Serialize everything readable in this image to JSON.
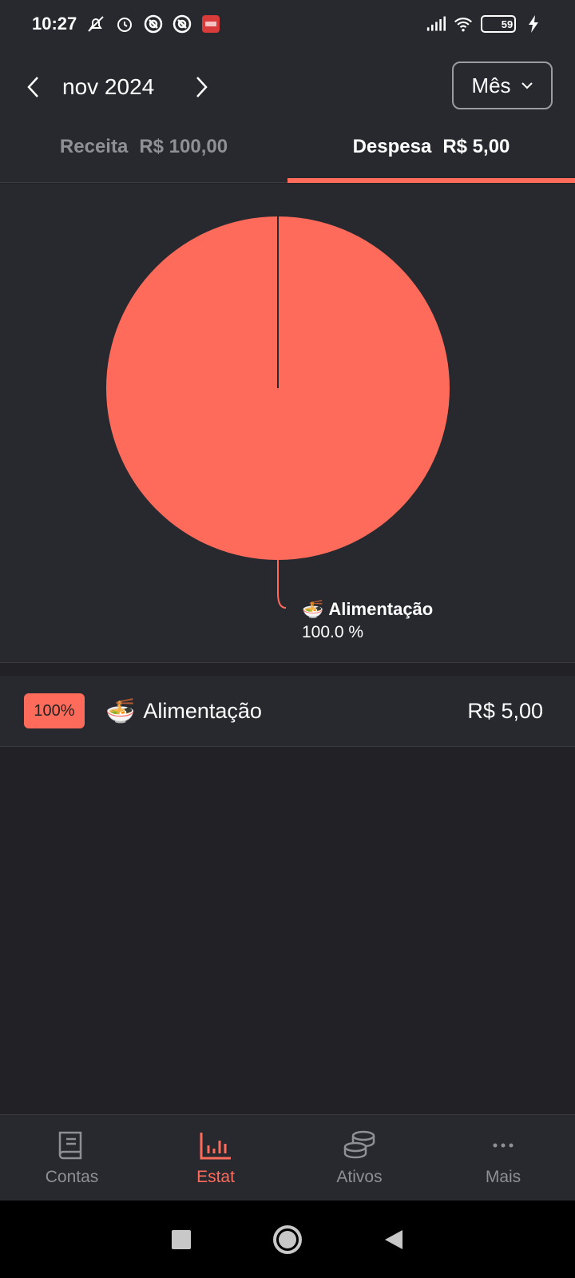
{
  "status_bar": {
    "time": "10:27",
    "battery": "59"
  },
  "header": {
    "month": "nov 2024",
    "period": "Mês"
  },
  "tabs": [
    {
      "label": "Receita",
      "amount": "R$ 100,00",
      "active": false
    },
    {
      "label": "Despesa",
      "amount": "R$ 5,00",
      "active": true
    }
  ],
  "chart_data": {
    "type": "pie",
    "slices": [
      {
        "label": "Alimentação",
        "icon": "🍜",
        "value": 100.0,
        "color": "#ff6b5b"
      }
    ],
    "labels": [
      {
        "name": "Alimentação",
        "pct": "100.0 %"
      }
    ]
  },
  "list": [
    {
      "pct": "100%",
      "icon": "🍜",
      "name": "Alimentação",
      "amount": "R$ 5,00"
    }
  ],
  "bottom_nav": [
    {
      "label": "Contas",
      "icon": "book-icon",
      "active": false
    },
    {
      "label": "Estat",
      "icon": "bar-chart-icon",
      "active": true
    },
    {
      "label": "Ativos",
      "icon": "coins-icon",
      "active": false
    },
    {
      "label": "Mais",
      "icon": "more-icon",
      "active": false
    }
  ],
  "colors": {
    "accent": "#ff6b5b",
    "background": "#222226",
    "surface": "#27292f"
  }
}
